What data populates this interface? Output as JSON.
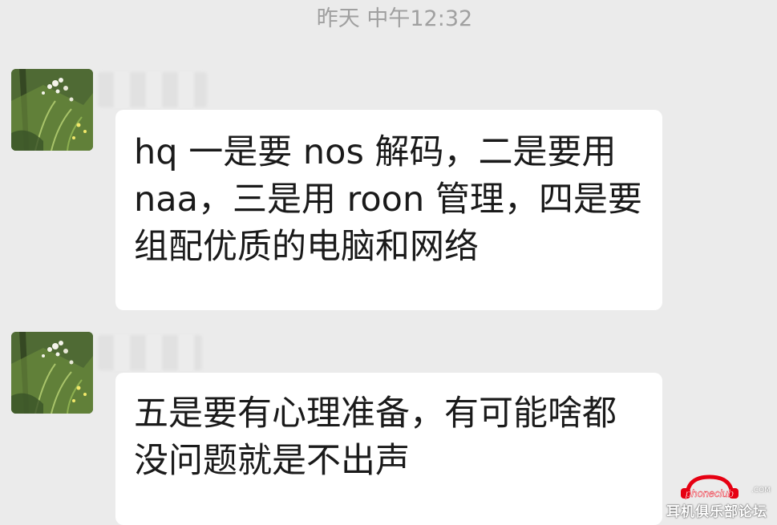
{
  "header": {
    "timestamp": "昨天 中午12:32"
  },
  "messages": [
    {
      "lines": [
        "hq 一是要 nos 解码，二是要用",
        "naa，三是用 roon 管理，四是要",
        "组配优质的电脑和网络"
      ]
    },
    {
      "lines": [
        "五是要有心理准备，有可能啥都",
        "没问题就是不出声"
      ]
    }
  ],
  "watermark": {
    "text": "耳机俱乐部论坛",
    "domain": ".COM"
  },
  "colors": {
    "background": "#ebebeb",
    "bubble": "#ffffff",
    "text": "#1a1a1a",
    "timestamp": "#a0a0a0",
    "watermark_red": "#e60012"
  },
  "icons": {
    "avatar": "plant-photo-avatar",
    "watermark_logo": "headphone-logo-icon"
  }
}
